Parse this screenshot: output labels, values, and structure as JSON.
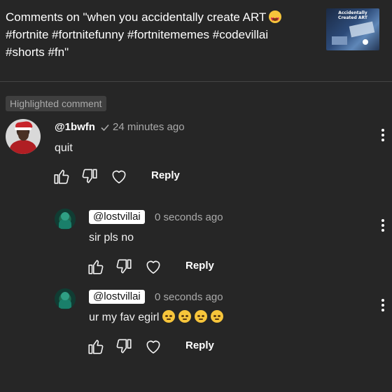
{
  "header": {
    "title": "Comments on \"when you accidentally create ART",
    "title_line2": "#fortnite #fortnitefunny #fortnitememes #codevillai",
    "title_line3": "#shorts #fn\"",
    "thumbnail_caption": "Accidentally Created ART"
  },
  "badge": {
    "label": "Highlighted comment"
  },
  "comments": [
    {
      "author": "@1bwfn",
      "verified_icon": "check-icon",
      "time": "24 minutes ago",
      "text": "quit",
      "reply_label": "Reply"
    },
    {
      "author": "@lostvillai",
      "time": "0 seconds ago",
      "text": "sir pls no",
      "reply_label": "Reply"
    },
    {
      "author": "@lostvillai",
      "time": "0 seconds ago",
      "text": "ur my fav egirl",
      "emoji_count": 4,
      "reply_label": "Reply"
    }
  ],
  "colors": {
    "background": "#262626",
    "badge_bg": "#3f3f3f",
    "muted_text": "#aaaaaa"
  }
}
